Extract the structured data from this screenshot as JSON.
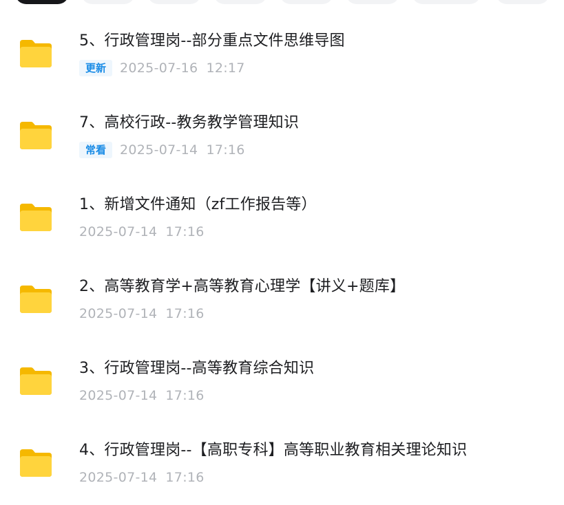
{
  "chips": [
    {
      "state": "active"
    },
    {
      "state": "inactive"
    },
    {
      "state": "inactive"
    },
    {
      "state": "inactive"
    },
    {
      "state": "inactive"
    },
    {
      "state": "inactive"
    },
    {
      "state": "inactive"
    },
    {
      "state": "inactive"
    }
  ],
  "folder_icon": "folder-icon",
  "colors": {
    "folder_front": "#ffd43d",
    "folder_back": "#f5b800",
    "tag_text": "#1a8ce6",
    "tag_bg": "#eef6fd",
    "time_text": "#b0b3b8",
    "title_text": "#1d1e21"
  },
  "files": [
    {
      "title": "5、行政管理岗--部分重点文件思维导图",
      "tag": "更新",
      "date": "2025-07-16",
      "time": "12:17"
    },
    {
      "title": "7、高校行政--教务教学管理知识",
      "tag": "常看",
      "date": "2025-07-14",
      "time": "17:16"
    },
    {
      "title": "1、新增文件通知（zf工作报告等）",
      "tag": "",
      "date": "2025-07-14",
      "time": "17:16"
    },
    {
      "title": "2、高等教育学+高等教育心理学【讲义+题库】",
      "tag": "",
      "date": "2025-07-14",
      "time": "17:16"
    },
    {
      "title": "3、行政管理岗--高等教育综合知识",
      "tag": "",
      "date": "2025-07-14",
      "time": "17:16"
    },
    {
      "title": "4、行政管理岗--【高职专科】高等职业教育相关理论知识",
      "tag": "",
      "date": "2025-07-14",
      "time": "17:16"
    }
  ]
}
